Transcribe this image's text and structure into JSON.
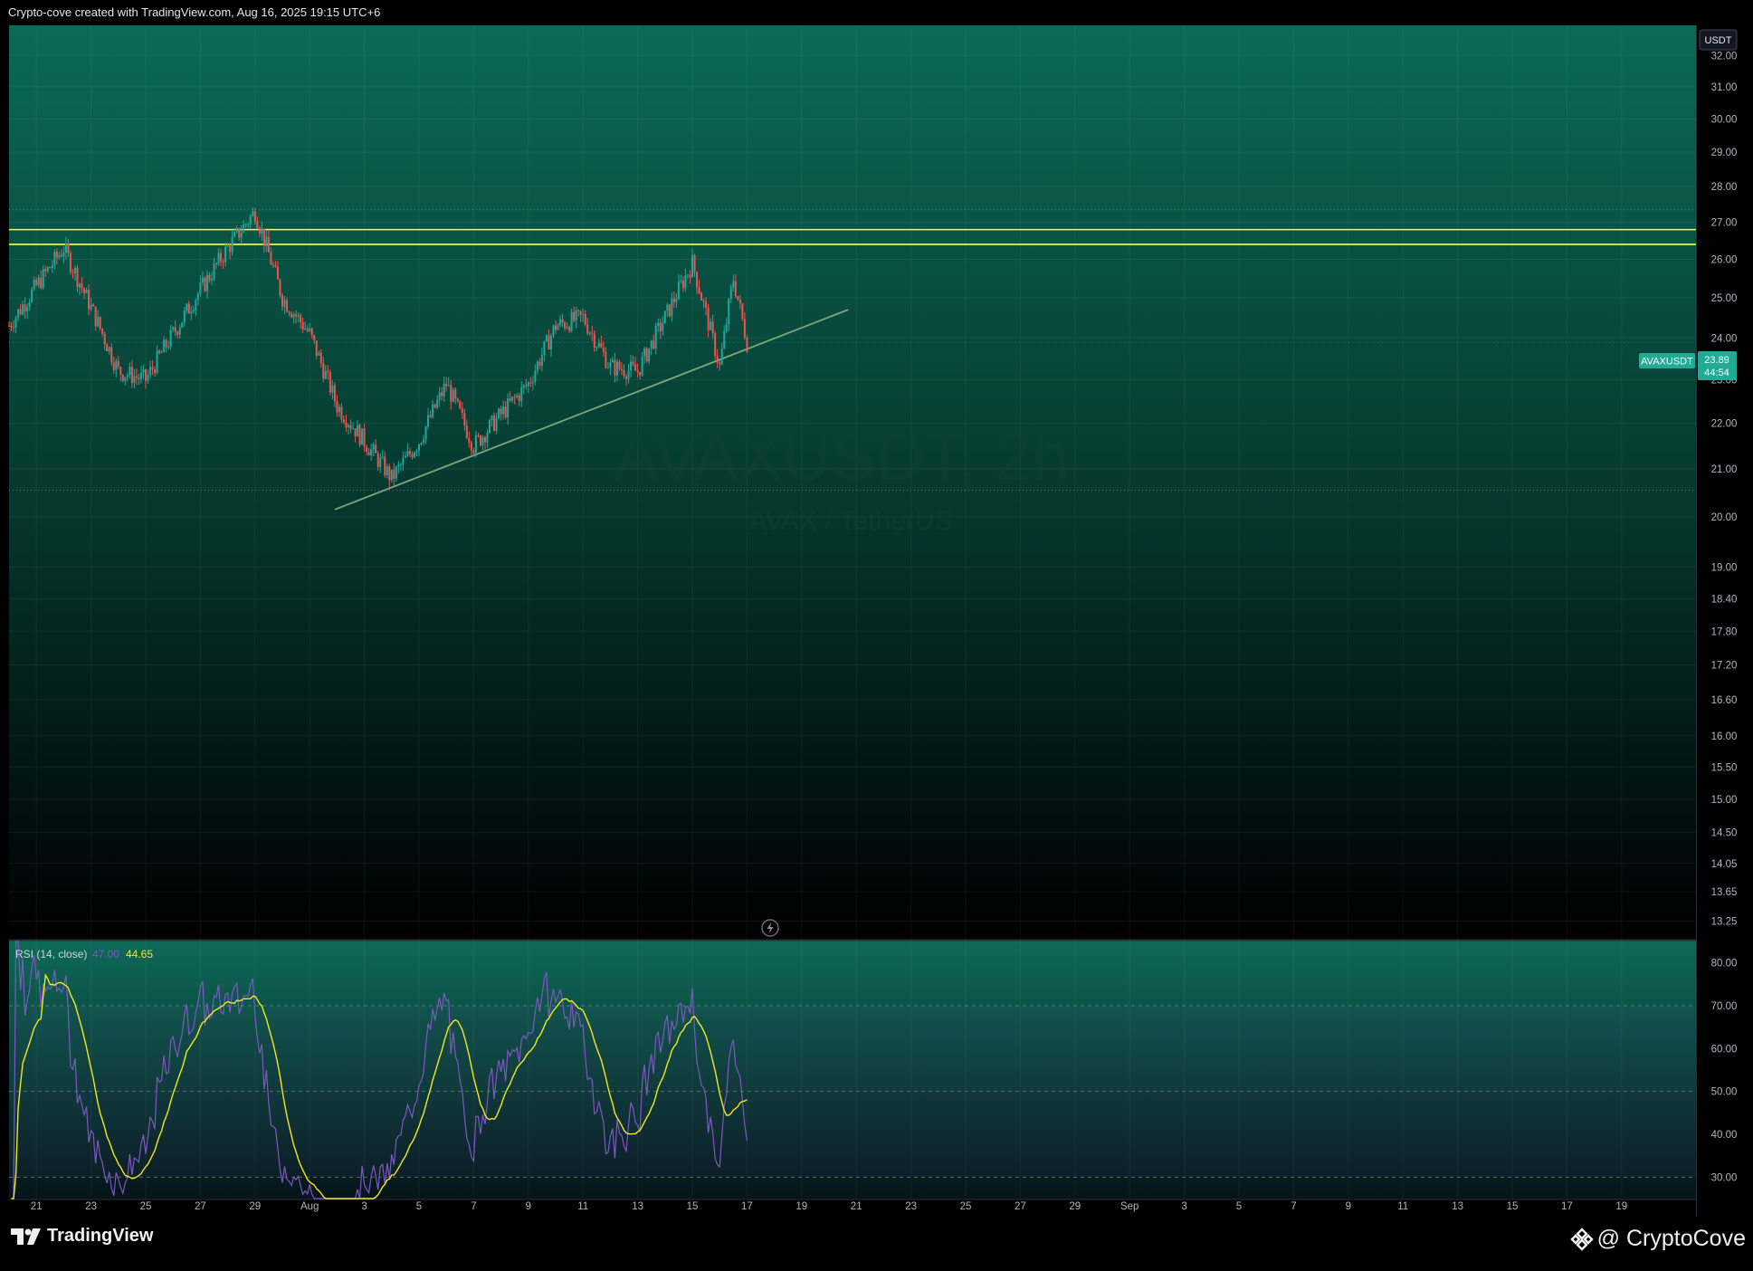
{
  "header": {
    "caption": "Crypto-cove created with TradingView.com, Aug 16, 2025 19:15 UTC+6"
  },
  "watermark": {
    "symbol": "AVAXUSDT, 2h",
    "name": "AVAX / TetherUS"
  },
  "price_axis": {
    "currency_badge": "USDT",
    "ticks": [
      "32.00",
      "31.00",
      "30.00",
      "29.00",
      "28.00",
      "27.00",
      "26.00",
      "25.00",
      "24.00",
      "23.00",
      "22.00",
      "21.00",
      "20.00",
      "19.00",
      "18.40",
      "17.80",
      "17.20",
      "16.60",
      "16.00",
      "15.50",
      "15.00",
      "14.50",
      "14.05",
      "13.65",
      "13.25"
    ]
  },
  "symbol_tag": {
    "label": "AVAXUSDT",
    "price": "23.89",
    "countdown": "44:54",
    "color": "#22ab94"
  },
  "time_axis": {
    "ticks": [
      "21",
      "23",
      "25",
      "27",
      "29",
      "Aug",
      "3",
      "5",
      "7",
      "9",
      "11",
      "13",
      "15",
      "17",
      "19",
      "21",
      "23",
      "25",
      "27",
      "29",
      "Sep",
      "3",
      "5",
      "7",
      "9",
      "11",
      "13",
      "15",
      "17",
      "19"
    ]
  },
  "rsi_panel": {
    "title": "RSI (14, close)",
    "value_rsi": "47.00",
    "value_ma": "44.65",
    "ticks": [
      "80.00",
      "70.00",
      "60.00",
      "50.00",
      "40.00",
      "30.00"
    ],
    "colors": {
      "rsi": "#7e57c2",
      "ma": "#f2e81c"
    }
  },
  "footer": {
    "brand": "TradingView",
    "author": "@ CryptoCove"
  },
  "colors": {
    "bullish_candle": "#26a69a",
    "bearish_candle": "#ef5350",
    "resistance_lines": "#ffff44",
    "trendline": "#7fa878",
    "background_top": "#0b5f4f"
  },
  "chart_data": {
    "type": "candlestick",
    "symbol": "AVAXUSDT",
    "interval": "2h",
    "y_scale": "log",
    "ylim": [
      13.0,
      33.0
    ],
    "key_points": [
      {
        "date": "2025-07-20",
        "close": 24.3
      },
      {
        "date": "2025-07-22",
        "close": 26.3
      },
      {
        "date": "2025-07-24",
        "close": 23.2
      },
      {
        "date": "2025-07-25",
        "close": 23.0
      },
      {
        "date": "2025-07-27",
        "close": 25.2
      },
      {
        "date": "2025-07-28",
        "close": 26.3
      },
      {
        "date": "2025-07-29",
        "close": 27.3
      },
      {
        "date": "2025-07-30",
        "close": 25.0
      },
      {
        "date": "2025-07-31",
        "close": 24.1
      },
      {
        "date": "2025-08-01",
        "close": 22.4
      },
      {
        "date": "2025-08-02",
        "close": 21.6
      },
      {
        "date": "2025-08-03",
        "close": 20.8
      },
      {
        "date": "2025-08-04",
        "close": 21.6
      },
      {
        "date": "2025-08-05",
        "close": 22.9
      },
      {
        "date": "2025-08-06",
        "close": 21.5
      },
      {
        "date": "2025-08-07",
        "close": 22.2
      },
      {
        "date": "2025-08-08",
        "close": 22.9
      },
      {
        "date": "2025-08-09",
        "close": 24.3
      },
      {
        "date": "2025-08-10",
        "close": 24.5
      },
      {
        "date": "2025-08-11",
        "close": 23.3
      },
      {
        "date": "2025-08-12",
        "close": 23.2
      },
      {
        "date": "2025-08-13",
        "close": 24.5
      },
      {
        "date": "2025-08-14",
        "close": 25.9
      },
      {
        "date": "2025-08-15",
        "close": 23.3
      },
      {
        "date": "2025-08-15T12:00",
        "close": 25.5
      },
      {
        "date": "2025-08-16",
        "close": 23.89
      }
    ],
    "resistance_levels": [
      26.8,
      26.4
    ],
    "trendline": {
      "start": {
        "date": "2025-07-31",
        "price": 20.15
      },
      "end": {
        "date": "2025-08-19",
        "price": 24.7
      }
    },
    "rsi": {
      "period": 14,
      "bands": [
        70,
        50,
        30
      ],
      "ylim": [
        25,
        85
      ],
      "last_rsi": 47.0,
      "last_ma": 44.65
    }
  }
}
